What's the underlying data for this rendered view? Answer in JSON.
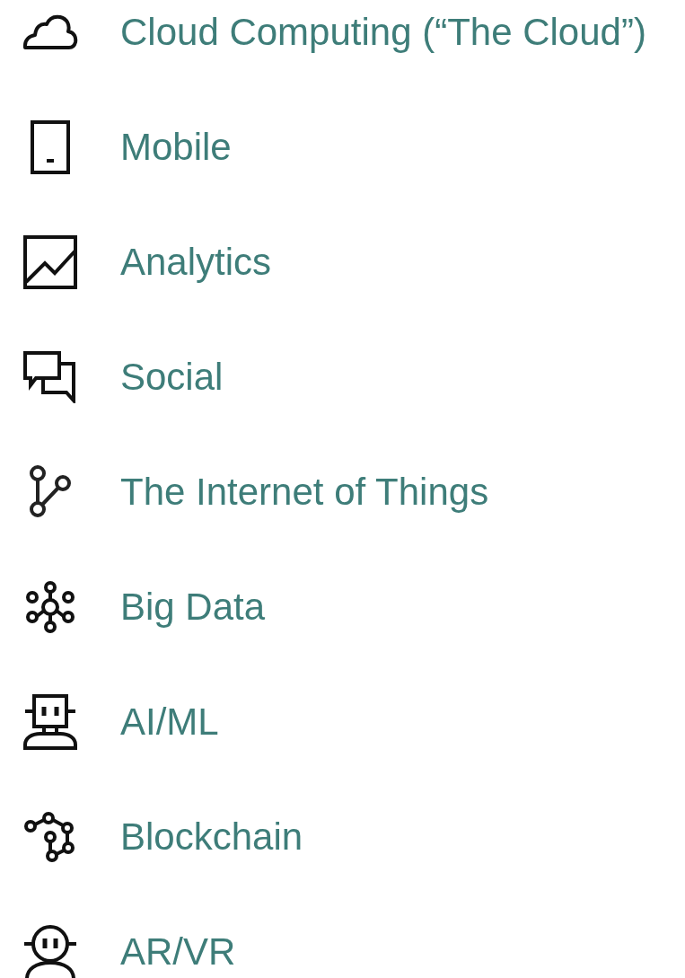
{
  "items": [
    {
      "kind": "cloud",
      "label": "Cloud Computing (“The Cloud”)"
    },
    {
      "kind": "mobile",
      "label": "Mobile"
    },
    {
      "kind": "chart",
      "label": "Analytics"
    },
    {
      "kind": "chat",
      "label": "Social"
    },
    {
      "kind": "branch",
      "label": "The Internet of Things"
    },
    {
      "kind": "hub",
      "label": "Big Data"
    },
    {
      "kind": "robot",
      "label": "AI/ML"
    },
    {
      "kind": "chain",
      "label": "Blockchain"
    },
    {
      "kind": "avatar",
      "label": "AR/VR"
    }
  ]
}
